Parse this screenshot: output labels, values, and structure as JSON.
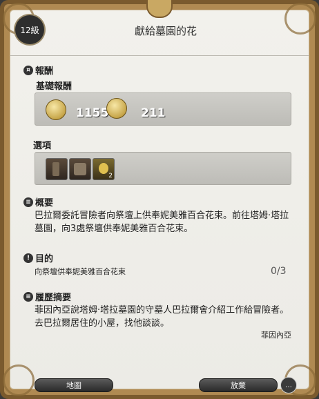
{
  "header": {
    "level": "12級",
    "title": "獻給墓園的花"
  },
  "rewards": {
    "label": "報酬",
    "base_label": "基礎報酬",
    "exp": "1155",
    "gil": "211",
    "optional_label": "選項",
    "optional_items": [
      {
        "icon": "boots-icon"
      },
      {
        "icon": "boots-pair-icon"
      },
      {
        "icon": "potion-icon",
        "count": "2"
      }
    ]
  },
  "summary": {
    "label": "概要",
    "text": "巴拉爾委託冒險者向祭壇上供奉妮美雅百合花束。前往塔姆·塔拉墓園，向3處祭壇供奉妮美雅百合花束。"
  },
  "objective": {
    "label": "目的",
    "text": "向祭壇供奉妮美雅百合花束",
    "progress": "0/3"
  },
  "history": {
    "label": "履歷摘要",
    "text": "菲因內亞說塔姆·塔拉墓園的守墓人巴拉爾會介紹工作給冒險者。去巴拉爾居住的小屋，找他談談。",
    "signature": "菲因內亞"
  },
  "footer": {
    "map_button": "地圖",
    "abandon_button": "放棄"
  }
}
